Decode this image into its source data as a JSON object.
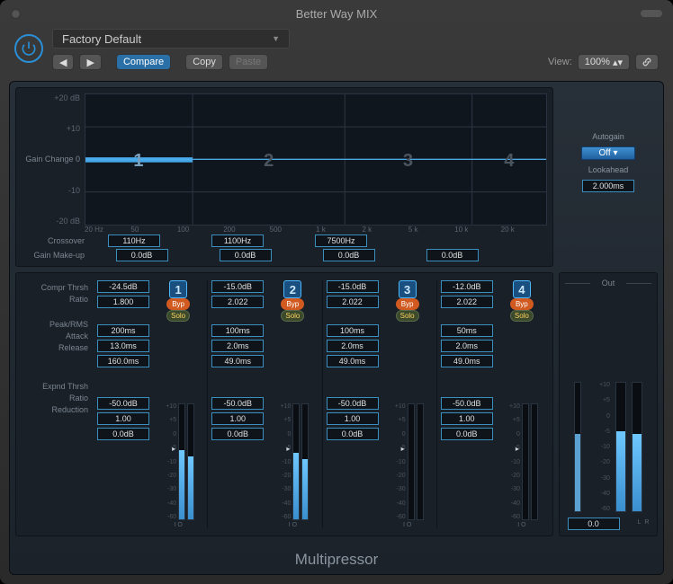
{
  "window": {
    "title": "Better Way MIX"
  },
  "toolbar": {
    "preset": "Factory Default",
    "compare": "Compare",
    "copy": "Copy",
    "paste": "Paste",
    "viewLabel": "View:",
    "viewValue": "100%"
  },
  "graph": {
    "ylabels": [
      "+20 dB",
      "+10",
      "0",
      "-10",
      "-20 dB"
    ],
    "gainChangeLabel": "Gain Change",
    "xlabels": [
      "20 Hz",
      "50",
      "100",
      "200",
      "500",
      "1 k",
      "2 k",
      "5 k",
      "10 k",
      "20 k"
    ],
    "bands": [
      "1",
      "2",
      "3",
      "4"
    ],
    "crossoverLabel": "Crossover",
    "crossover": [
      "110Hz",
      "1100Hz",
      "7500Hz"
    ],
    "gainMakeupLabel": "Gain Make-up",
    "gainMakeup": [
      "0.0dB",
      "0.0dB",
      "0.0dB",
      "0.0dB"
    ]
  },
  "side": {
    "autogainLabel": "Autogain",
    "autogain": "Off",
    "lookaheadLabel": "Lookahead",
    "lookahead": "2.000ms"
  },
  "rows": {
    "comprThrsh": "Compr Thrsh",
    "ratio": "Ratio",
    "peakRms": "Peak/RMS",
    "attack": "Attack",
    "release": "Release",
    "expndThrsh": "Expnd Thrsh",
    "ratio2": "Ratio",
    "reduction": "Reduction"
  },
  "bands": [
    {
      "num": "1",
      "thrsh": "-24.5dB",
      "ratio": "1.800",
      "peakrms": "200ms",
      "attack": "13.0ms",
      "release": "160.0ms",
      "ethrsh": "-50.0dB",
      "eratio": "1.00",
      "reduc": "0.0dB",
      "byp": "Byp",
      "solo": "Solo",
      "meterI": 60,
      "meterO": 55,
      "io": "I   O"
    },
    {
      "num": "2",
      "thrsh": "-15.0dB",
      "ratio": "2.022",
      "peakrms": "100ms",
      "attack": "2.0ms",
      "release": "49.0ms",
      "ethrsh": "-50.0dB",
      "eratio": "1.00",
      "reduc": "0.0dB",
      "byp": "Byp",
      "solo": "Solo",
      "meterI": 58,
      "meterO": 52,
      "io": "I   O"
    },
    {
      "num": "3",
      "thrsh": "-15.0dB",
      "ratio": "2.022",
      "peakrms": "100ms",
      "attack": "2.0ms",
      "release": "49.0ms",
      "ethrsh": "-50.0dB",
      "eratio": "1.00",
      "reduc": "0.0dB",
      "byp": "Byp",
      "solo": "Solo",
      "meterI": 0,
      "meterO": 0,
      "io": "I   O"
    },
    {
      "num": "4",
      "thrsh": "-12.0dB",
      "ratio": "2.022",
      "peakrms": "50ms",
      "attack": "2.0ms",
      "release": "49.0ms",
      "ethrsh": "-50.0dB",
      "eratio": "1.00",
      "reduc": "0.0dB",
      "byp": "Byp",
      "solo": "Solo",
      "meterI": 0,
      "meterO": 0,
      "io": "I   O"
    }
  ],
  "meterScale": [
    "+10",
    "+5",
    "0",
    "-5",
    "-10",
    "-20",
    "-30",
    "-40",
    "-60"
  ],
  "out": {
    "title": "Out",
    "scale": [
      "+10",
      "+5",
      "0",
      "-5",
      "-10",
      "-20",
      "-30",
      "-40",
      "-60"
    ],
    "value": "0.0",
    "L": "L",
    "R": "R",
    "meterL": 62,
    "meterR": 60
  },
  "footer": "Multipressor"
}
